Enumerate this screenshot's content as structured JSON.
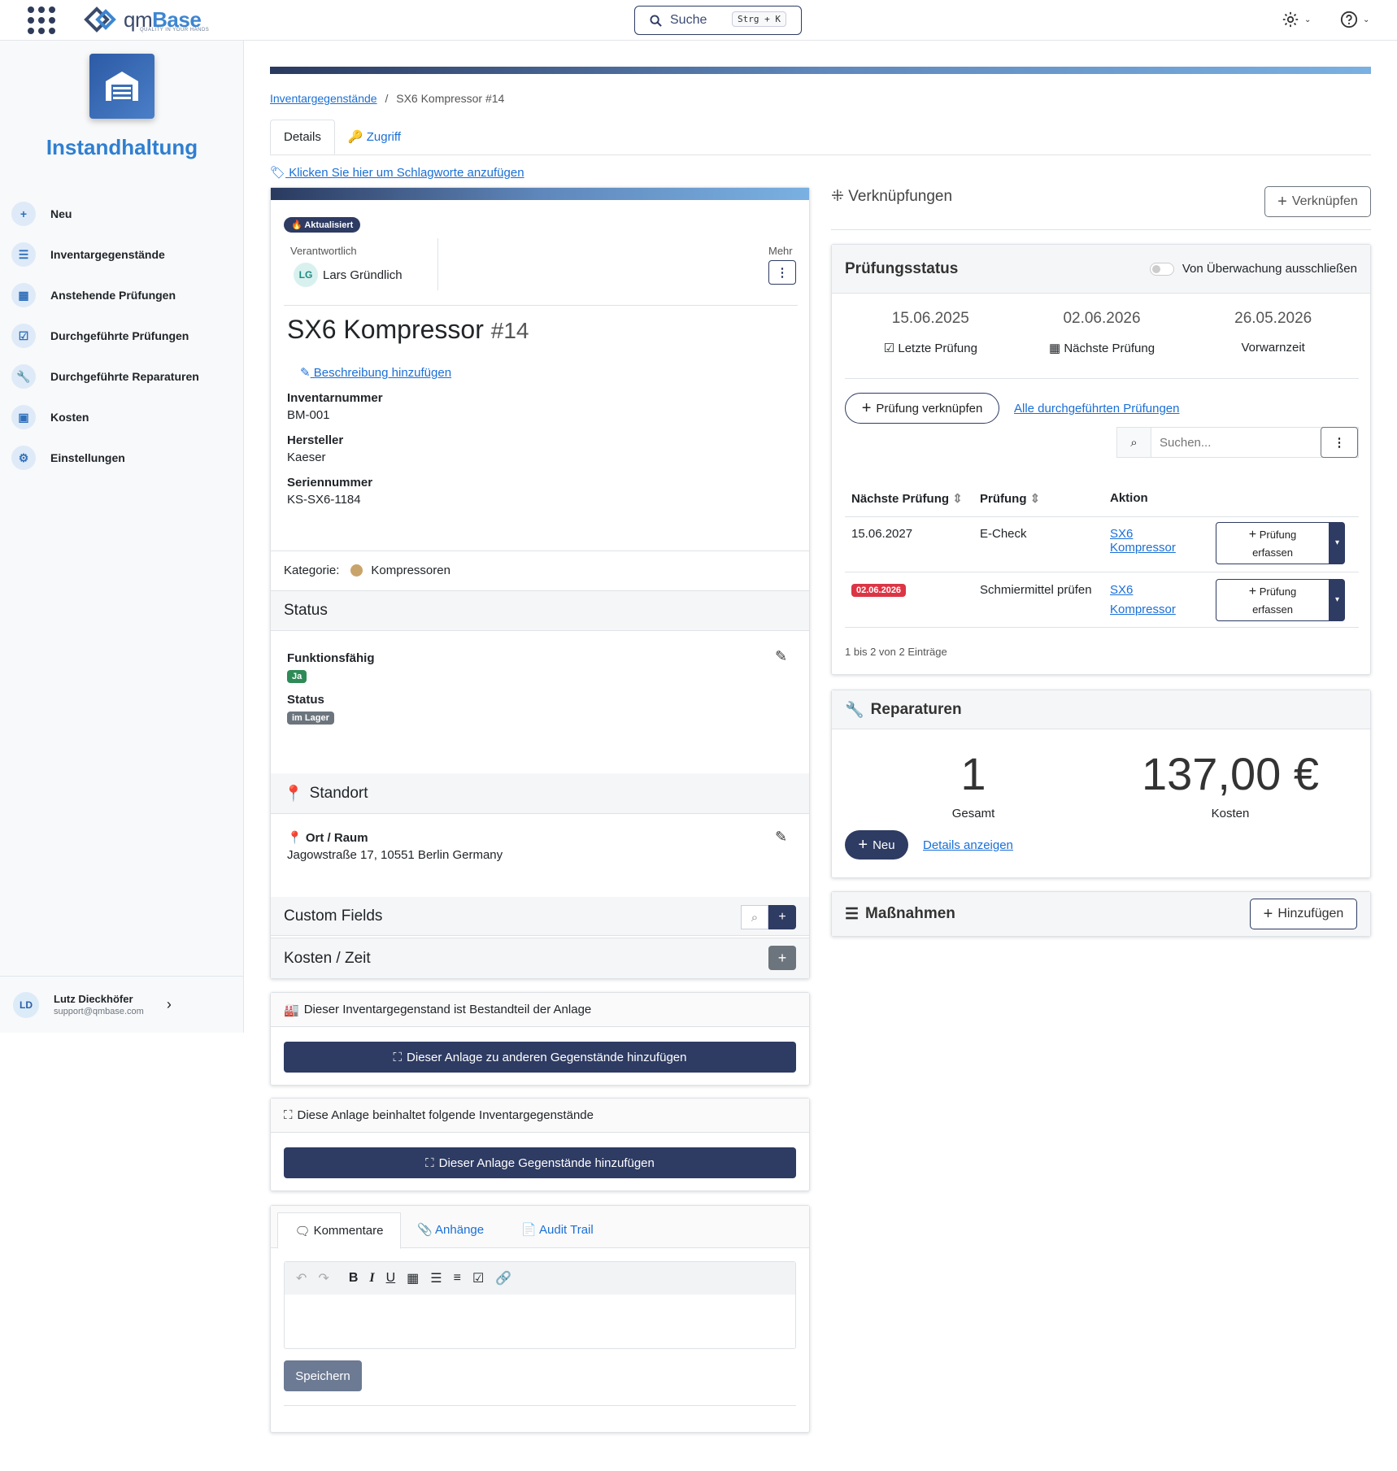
{
  "topbar": {
    "logo_prefix": "qm",
    "logo_brand": "Base",
    "logo_tagline": "QUALITY IN YOUR HANDS",
    "search_label": "Suche",
    "search_shortcut": "Strg + K"
  },
  "sidebar": {
    "app_title": "Instandhaltung",
    "items": [
      {
        "label": "Neu",
        "icon": "plus-icon"
      },
      {
        "label": "Inventargegenstände",
        "icon": "list-icon"
      },
      {
        "label": "Anstehende Prüfungen",
        "icon": "calendar-icon"
      },
      {
        "label": "Durchgeführte Prüfungen",
        "icon": "check-square-icon"
      },
      {
        "label": "Durchgeführte Reparaturen",
        "icon": "wrench-icon"
      },
      {
        "label": "Kosten",
        "icon": "money-icon"
      },
      {
        "label": "Einstellungen",
        "icon": "gear-icon"
      }
    ],
    "user": {
      "initials": "LD",
      "name": "Lutz Dieckhöfer",
      "email": "support@qmbase.com"
    }
  },
  "breadcrumb": {
    "parent": "Inventargegenstände",
    "separator": "/",
    "current": "SX6 Kompressor #14"
  },
  "tabs": {
    "details": "Details",
    "access": "Zugriff"
  },
  "tag_link": " Klicken Sie hier um Schlagworte anzufügen",
  "item": {
    "badge": "Aktualisiert",
    "responsible_label": "Verantwortlich",
    "responsible_initials": "LG",
    "responsible_name": "Lars Gründlich",
    "more_label": "Mehr",
    "title": "SX6 Kompressor",
    "number": "#14",
    "add_description": " Beschreibung hinzufügen",
    "fields": [
      {
        "label": "Inventarnummer",
        "value": "BM-001"
      },
      {
        "label": "Hersteller",
        "value": "Kaeser"
      },
      {
        "label": "Seriennummer",
        "value": "KS-SX6-1184"
      }
    ],
    "category_label": "Kategorie:",
    "category_value": "Kompressoren",
    "category_color": "#c9a46a"
  },
  "status_section": {
    "title": "Status",
    "functional_label": "Funktionsfähig",
    "functional_value": "Ja",
    "status_label": "Status",
    "status_value": "im Lager"
  },
  "location_section": {
    "title": "Standort",
    "place_label": "Ort / Raum",
    "place_value": "Jagowstraße 17, 10551 Berlin Germany"
  },
  "custom_fields": {
    "title": "Custom Fields"
  },
  "costs_time": {
    "title": "Kosten / Zeit"
  },
  "part_of": {
    "header": "Dieser Inventargegenstand ist Bestandteil der Anlage",
    "button": "Dieser Anlage zu anderen Gegenstände hinzufügen"
  },
  "contains": {
    "header": "Diese Anlage beinhaltet folgende Inventargegenstände",
    "button": "Dieser Anlage Gegenstände hinzufügen"
  },
  "comments": {
    "tab_comments": "Kommentare",
    "tab_attachments": "Anhänge",
    "tab_audit": "Audit Trail",
    "save": "Speichern"
  },
  "links": {
    "title": "Verknüpfungen",
    "button": "Verknüpfen"
  },
  "inspection": {
    "title": "Prüfungsstatus",
    "exclude_label": "Von Überwachung ausschließen",
    "dates": [
      {
        "date": "15.06.2025",
        "label": "Letzte Prüfung",
        "icon": "check-square-icon"
      },
      {
        "date": "02.06.2026",
        "label": "Nächste Prüfung",
        "icon": "calendar-icon"
      },
      {
        "date": "26.05.2026",
        "label": "Vorwarnzeit",
        "icon": ""
      }
    ],
    "link_button": "Prüfung verknüpfen",
    "all_link": "Alle durchgeführten Prüfungen",
    "search_placeholder": "Suchen...",
    "columns": [
      "Nächste Prüfung",
      "Prüfung",
      "Aktion"
    ],
    "rows": [
      {
        "next": "15.06.2027",
        "overdue": false,
        "test": "E-Check",
        "action_line1": "SX6",
        "action_line2": "Kompressor",
        "btn_line1": "Prüfung",
        "btn_line2": "erfassen"
      },
      {
        "next": "02.06.2026",
        "overdue": true,
        "test": "Schmiermittel prüfen",
        "action_line1": "SX6",
        "action_line2": "Kompressor",
        "btn_line1": "Prüfung",
        "btn_line2": "erfassen"
      }
    ],
    "footer": "1 bis 2 von 2 Einträge"
  },
  "repairs": {
    "title": "Reparaturen",
    "total_value": "1",
    "total_label": "Gesamt",
    "cost_value": "137,00 €",
    "cost_label": "Kosten",
    "new_button": "Neu",
    "details_link": "Details anzeigen"
  },
  "measures": {
    "title": "Maßnahmen",
    "button": "Hinzufügen"
  },
  "colors": {
    "primary": "#2e3b63",
    "link": "#1a6fd6",
    "danger": "#dc3545",
    "success": "#2e8b57",
    "secondary": "#6c757d"
  }
}
